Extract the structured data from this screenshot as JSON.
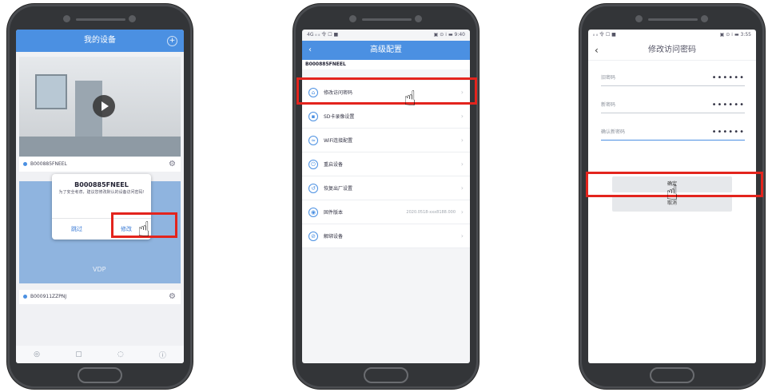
{
  "phone1": {
    "title": "我的设备",
    "device1_id": "B000885FNEEL",
    "device2_id": "B000911ZZPNJ",
    "dialog": {
      "title": "B000885FNEEL",
      "message": "为了安全考虑，建议您修改默认的设备访问密码!",
      "skip_label": "跳过",
      "modify_label": "修改"
    },
    "vdp_text": "VDP"
  },
  "phone2": {
    "status_left": "4G ᵢₗ ᵢₗ 令 ☐ ■",
    "status_right": "▣ ⊙ ⁞ ▬ 9:40",
    "title": "高级配置",
    "device_id": "B000885FNEEL",
    "items": [
      {
        "label": "修改访问密码",
        "value": ""
      },
      {
        "label": "SD卡录像设置",
        "value": ""
      },
      {
        "label": "WiFi连接配置",
        "value": ""
      },
      {
        "label": "重启设备",
        "value": ""
      },
      {
        "label": "恢复出厂设置",
        "value": ""
      },
      {
        "label": "固件版本",
        "value": "2020.0518-xxx8188.000"
      },
      {
        "label": "解绑设备",
        "value": ""
      }
    ]
  },
  "phone3": {
    "status_left": "ᵢₗ ᵢₗ 令 ☐ ■",
    "status_right": "▣ ⊙ ⁞ ▬ 3:55",
    "title": "修改访问密码",
    "fields": [
      {
        "label": "旧密码",
        "value": "••••••"
      },
      {
        "label": "新密码",
        "value": "••••••"
      },
      {
        "label": "确认新密码",
        "value": "••••••"
      }
    ],
    "confirm_label": "确定",
    "cancel_label": "取消"
  },
  "colors": {
    "accent": "#4b90e2",
    "highlight": "#e3241d"
  }
}
